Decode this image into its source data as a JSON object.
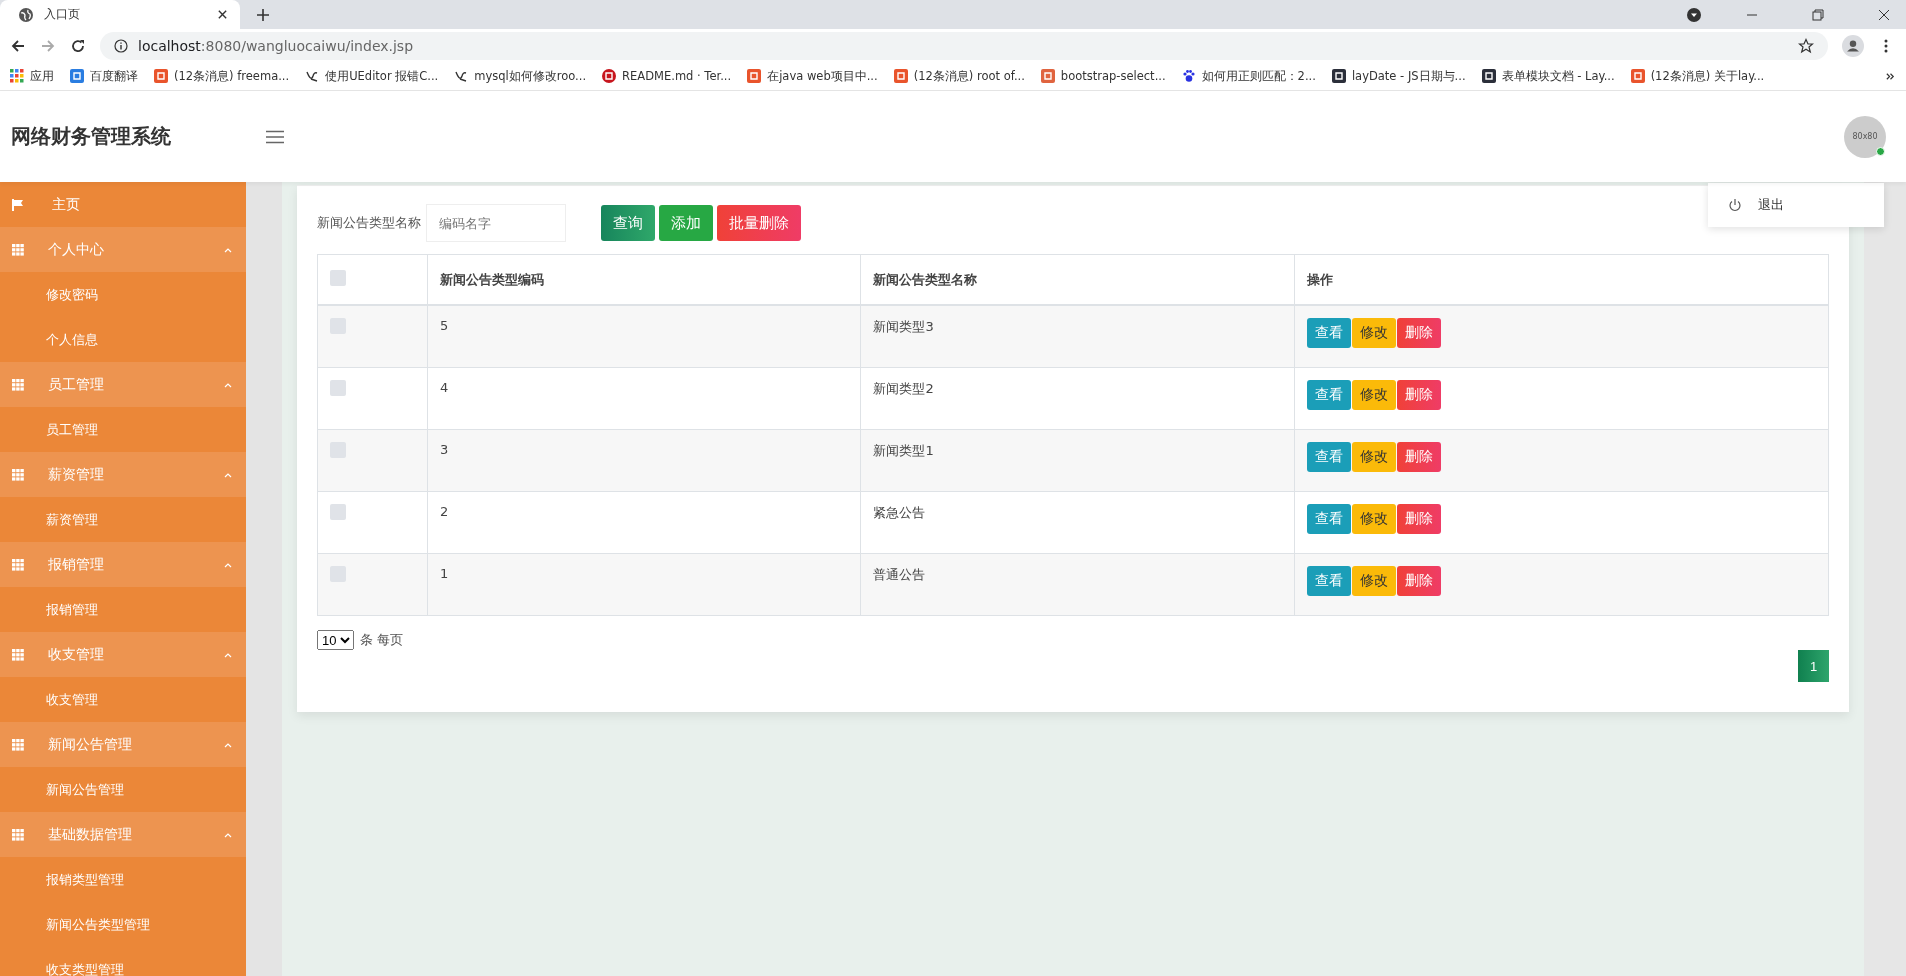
{
  "browser": {
    "tab": {
      "title": "入口页"
    },
    "url_host": "localhost",
    "url_rest": ":8080/wangluocaiwu/index.jsp",
    "bookmarks": [
      {
        "kind": "apps",
        "label": "应用"
      },
      {
        "kind": "translate",
        "label": "百度翻译"
      },
      {
        "kind": "csdn",
        "label": "(12条消息) freema..."
      },
      {
        "kind": "leaf",
        "label": "使用UEditor 报错C..."
      },
      {
        "kind": "leaf",
        "label": "mysql如何修改roo..."
      },
      {
        "kind": "git",
        "label": "README.md · Ter..."
      },
      {
        "kind": "csdn",
        "label": "在java web项目中..."
      },
      {
        "kind": "csdn",
        "label": "(12条消息) root of..."
      },
      {
        "kind": "jian",
        "label": "bootstrap-select..."
      },
      {
        "kind": "paw",
        "label": "如何用正则匹配：2..."
      },
      {
        "kind": "layui",
        "label": "layDate - JS日期与..."
      },
      {
        "kind": "layui",
        "label": "表单模块文档 - Lay..."
      },
      {
        "kind": "csdn",
        "label": "(12条消息) 关于lay..."
      }
    ]
  },
  "header": {
    "title": "网络财务管理系统",
    "avatar": "80x80",
    "online": true
  },
  "user_menu": {
    "items": [
      "退出"
    ]
  },
  "sidebar": {
    "items": [
      {
        "kind": "home",
        "label": "主页"
      },
      {
        "kind": "group",
        "label": "个人中心",
        "expanded": true,
        "children": [
          {
            "label": "修改密码"
          },
          {
            "label": "个人信息"
          }
        ]
      },
      {
        "kind": "group",
        "label": "员工管理",
        "expanded": true,
        "children": [
          {
            "label": "员工管理"
          }
        ]
      },
      {
        "kind": "group",
        "label": "薪资管理",
        "expanded": true,
        "children": [
          {
            "label": "薪资管理"
          }
        ]
      },
      {
        "kind": "group",
        "label": "报销管理",
        "expanded": true,
        "children": [
          {
            "label": "报销管理"
          }
        ]
      },
      {
        "kind": "group",
        "label": "收支管理",
        "expanded": true,
        "children": [
          {
            "label": "收支管理"
          }
        ]
      },
      {
        "kind": "group",
        "label": "新闻公告管理",
        "expanded": true,
        "children": [
          {
            "label": "新闻公告管理"
          }
        ]
      },
      {
        "kind": "group",
        "label": "基础数据管理",
        "expanded": true,
        "children": [
          {
            "label": "报销类型管理"
          },
          {
            "label": "新闻公告类型管理"
          },
          {
            "label": "收支类型管理"
          }
        ]
      }
    ]
  },
  "search": {
    "label": "新闻公告类型名称",
    "placeholder": "编码名字",
    "buttons": [
      {
        "kind": "query",
        "label": "查询"
      },
      {
        "kind": "add",
        "label": "添加"
      },
      {
        "kind": "delete",
        "label": "批量删除"
      }
    ]
  },
  "table": {
    "columns": [
      "新闻公告类型编码",
      "新闻公告类型名称",
      "操作"
    ],
    "all_checked": false,
    "rows": [
      {
        "checked": false,
        "code": "5",
        "name": "新闻类型3",
        "actions": [
          {
            "kind": "view",
            "label": "查看"
          },
          {
            "kind": "edit",
            "label": "修改"
          },
          {
            "kind": "delete",
            "label": "删除"
          }
        ]
      },
      {
        "checked": false,
        "code": "4",
        "name": "新闻类型2",
        "actions": [
          {
            "kind": "view",
            "label": "查看"
          },
          {
            "kind": "edit",
            "label": "修改"
          },
          {
            "kind": "delete",
            "label": "删除"
          }
        ]
      },
      {
        "checked": false,
        "code": "3",
        "name": "新闻类型1",
        "actions": [
          {
            "kind": "view",
            "label": "查看"
          },
          {
            "kind": "edit",
            "label": "修改"
          },
          {
            "kind": "delete",
            "label": "删除"
          }
        ]
      },
      {
        "checked": false,
        "code": "2",
        "name": "紧急公告",
        "actions": [
          {
            "kind": "view",
            "label": "查看"
          },
          {
            "kind": "edit",
            "label": "修改"
          },
          {
            "kind": "delete",
            "label": "删除"
          }
        ]
      },
      {
        "checked": false,
        "code": "1",
        "name": "普通公告",
        "actions": [
          {
            "kind": "view",
            "label": "查看"
          },
          {
            "kind": "edit",
            "label": "修改"
          },
          {
            "kind": "delete",
            "label": "删除"
          }
        ]
      }
    ]
  },
  "pagination": {
    "page_size": "10",
    "page_size_label": "条 每页",
    "pages": [
      {
        "label": "1",
        "selected": true
      }
    ]
  }
}
